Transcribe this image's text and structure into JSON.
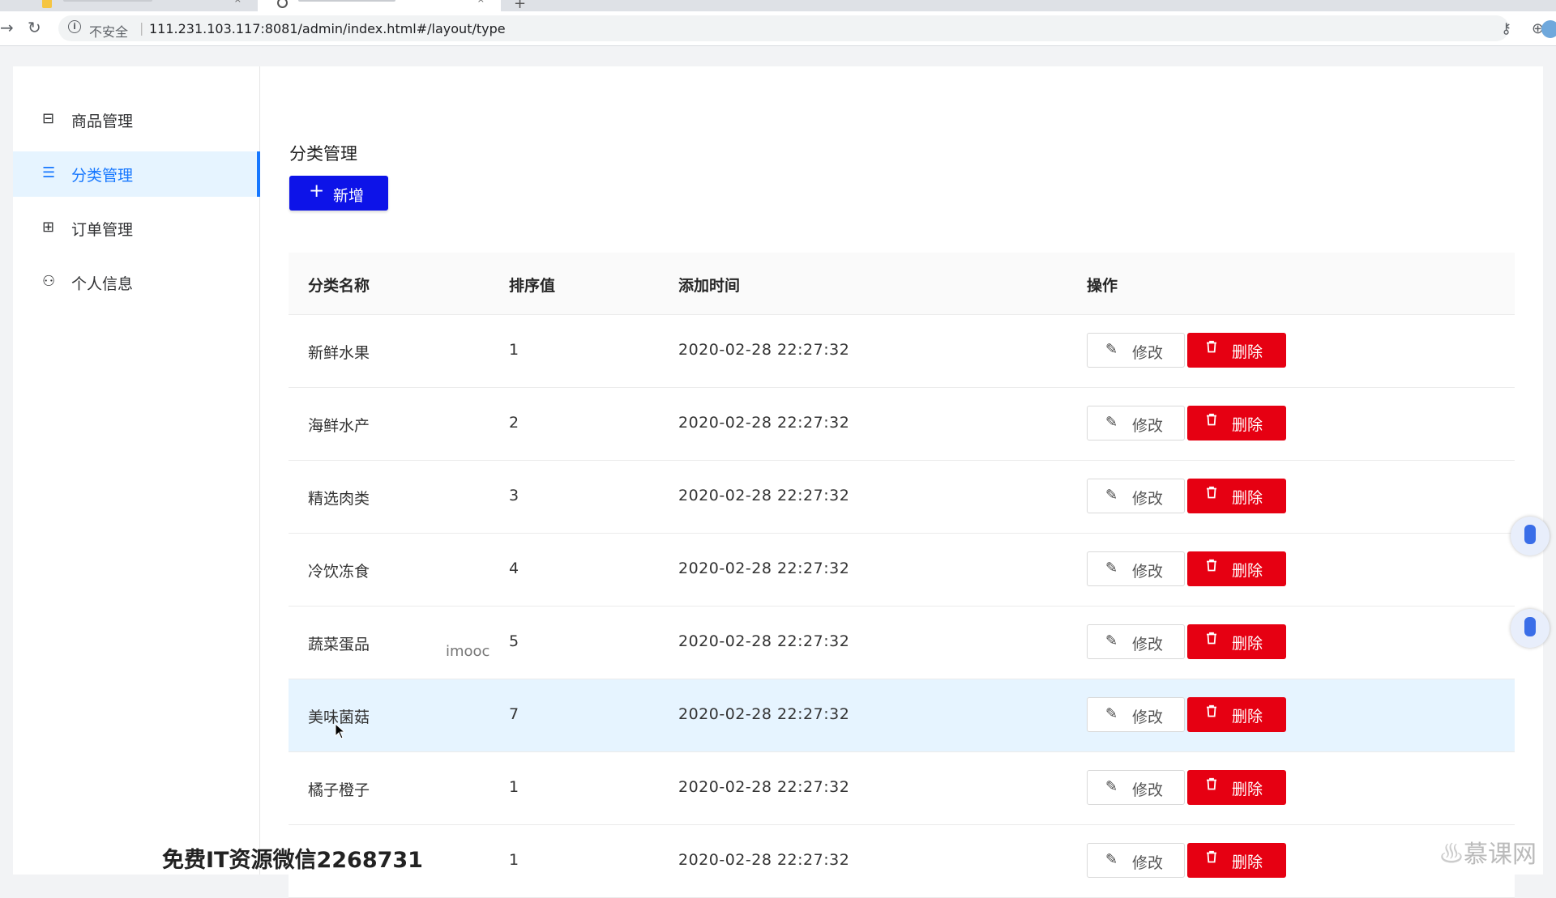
{
  "browser": {
    "security_label": "不安全",
    "separator": "|",
    "url": "111.231.103.117:8081/admin/index.html#/layout/type",
    "tab_close": "×",
    "new_tab": "+"
  },
  "sidebar": {
    "items": [
      {
        "label": "商品管理",
        "icon": "box-icon",
        "glyph": "⊟",
        "active": false
      },
      {
        "label": "分类管理",
        "icon": "list-icon",
        "glyph": "☰",
        "active": true
      },
      {
        "label": "订单管理",
        "icon": "order-icon",
        "glyph": "⊞",
        "active": false
      },
      {
        "label": "个人信息",
        "icon": "user-icon",
        "glyph": "⚇",
        "active": false
      }
    ]
  },
  "main": {
    "title": "分类管理",
    "add_label": "新增",
    "add_glyph": "+"
  },
  "table": {
    "columns": [
      "分类名称",
      "排序值",
      "添加时间",
      "操作"
    ],
    "edit_label": "修改",
    "delete_label": "删除",
    "rows": [
      {
        "name": "新鲜水果",
        "sort": "1",
        "time": "2020-02-28 22:27:32"
      },
      {
        "name": "海鲜水产",
        "sort": "2",
        "time": "2020-02-28 22:27:32"
      },
      {
        "name": "精选肉类",
        "sort": "3",
        "time": "2020-02-28 22:27:32"
      },
      {
        "name": "冷饮冻食",
        "sort": "4",
        "time": "2020-02-28 22:27:32"
      },
      {
        "name": "蔬菜蛋品",
        "sort": "5",
        "time": "2020-02-28 22:27:32"
      },
      {
        "name": "美味菌菇",
        "sort": "7",
        "time": "2020-02-28 22:27:32"
      },
      {
        "name": "橘子橙子",
        "sort": "1",
        "time": "2020-02-28 22:27:32"
      },
      {
        "name": "",
        "sort": "1",
        "time": "2020-02-28 22:27:32"
      }
    ]
  },
  "overlays": {
    "imooc": "imooc",
    "wechat": "免费IT资源微信2268731",
    "brand": "慕课网"
  },
  "colors": {
    "primary": "#0d13e8",
    "danger": "#e60012",
    "active_nav": "#1677ff",
    "active_bg": "#e6f4ff"
  }
}
